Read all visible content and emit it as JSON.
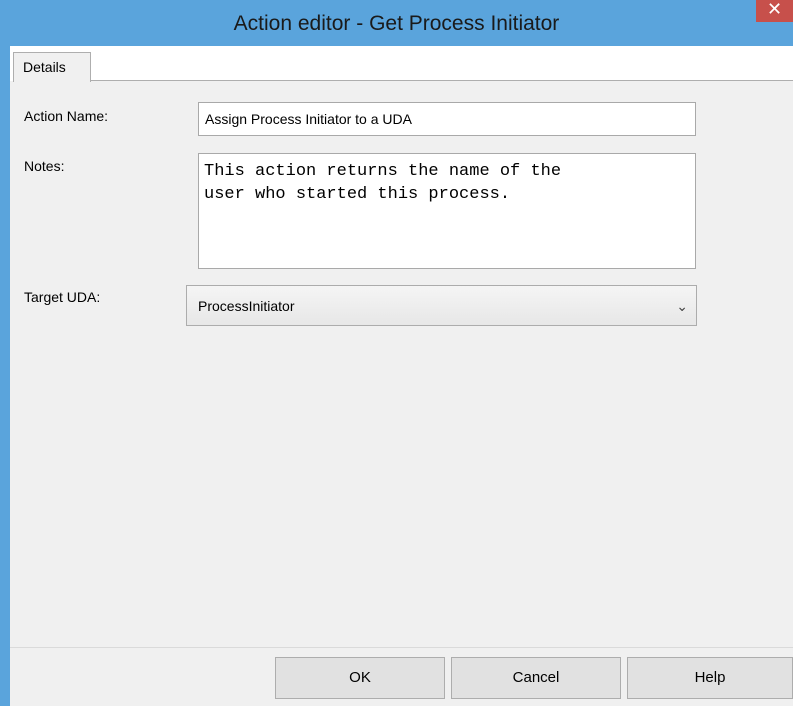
{
  "window": {
    "title": "Action editor - Get Process Initiator",
    "close_glyph": "✕"
  },
  "tabs": [
    {
      "label": "Details",
      "selected": true
    }
  ],
  "form": {
    "action_name": {
      "label": "Action Name:",
      "value": "Assign Process Initiator to a UDA"
    },
    "notes": {
      "label": "Notes:",
      "value": "This action returns the name of the\nuser who started this process."
    },
    "target_uda": {
      "label": "Target UDA:",
      "selected": "ProcessInitiator",
      "arrow_glyph": "⌄"
    }
  },
  "buttons": {
    "ok": "OK",
    "cancel": "Cancel",
    "help": "Help"
  },
  "colors": {
    "titlebar": "#5aa4dc",
    "close_button": "#c7504b",
    "dialog_background": "#f0f0f0"
  }
}
